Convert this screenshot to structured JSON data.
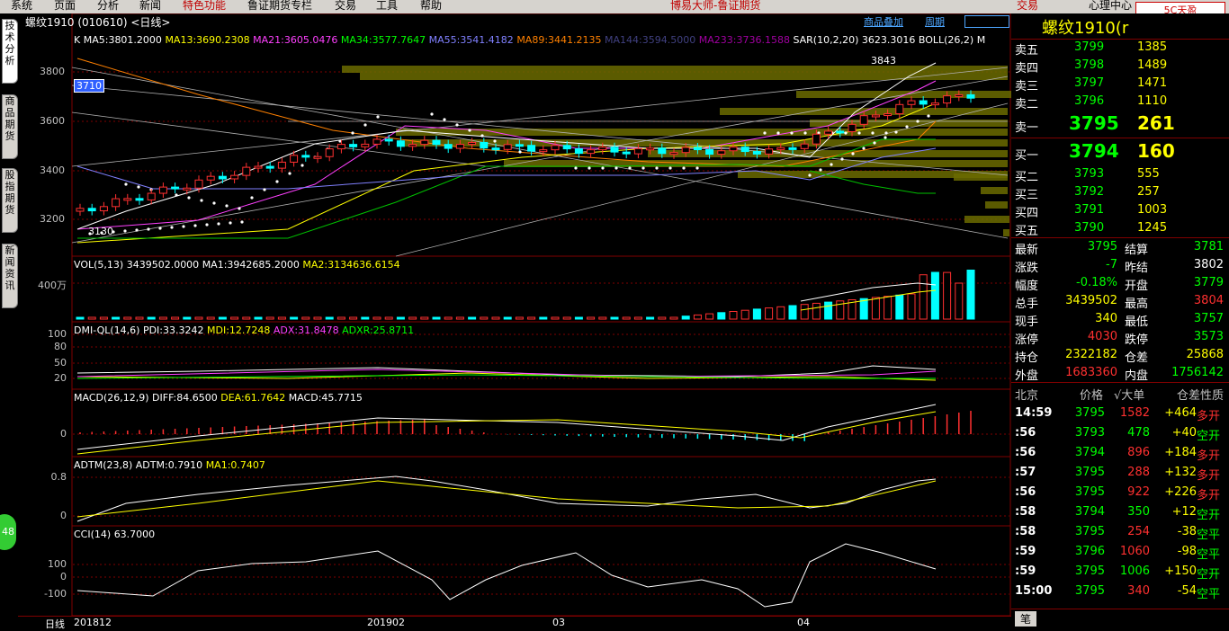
{
  "menu": [
    "系统",
    "页面",
    "分析",
    "新闻",
    "特色功能",
    "鲁证期货专栏",
    "交易",
    "工具",
    "帮助"
  ],
  "app_title": "博易大师-鲁证期货",
  "top_right": {
    "trade": "交易",
    "mind": "心理中心"
  },
  "left_tabs": [
    "技术分析",
    "商品期货",
    "股指期货",
    "新闻资讯"
  ],
  "left_badge": "48",
  "chart": {
    "header": "螺纹1910 (010610) <日线>",
    "overlay_btn": "商品叠加",
    "period_btn": "周期",
    "ma_line": {
      "k": "K",
      "ma5": "MA5:3801.2000",
      "ma13": "MA13:3690.2308",
      "ma21": "MA21:3605.0476",
      "ma34": "MA34:3577.7647",
      "ma55": "MA55:3541.4182",
      "ma89": "MA89:3441.2135",
      "ma144": "MA144:3594.5000",
      "ma233": "MA233:3736.1588",
      "sar": "SAR(10,2,20)",
      "sar_val": "3623.3016",
      "boll": "BOLL(26,2)",
      "boll_m": "M"
    },
    "price_axis": [
      "3800",
      "3600",
      "3400",
      "3200"
    ],
    "price_tag": "3710",
    "high_label": "3843",
    "low_label": "3130",
    "vol_line": {
      "title": "VOL(5,13)",
      "v": "3439502.0000",
      "ma1": "MA1:3942685.2000",
      "ma2": "MA2:3134636.6154"
    },
    "vol_axis": "400万",
    "dmi_line": {
      "title": "DMI-QL(14,6)",
      "pdi": "PDI:33.3242",
      "mdi": "MDI:12.7248",
      "adx": "ADX:31.8478",
      "adxr": "ADXR:25.8711"
    },
    "dmi_axis": [
      "100",
      "80",
      "50",
      "20"
    ],
    "macd_line": {
      "title": "MACD(26,12,9)",
      "diff": "DIFF:84.6500",
      "dea": "DEA:61.7642",
      "macd": "MACD:45.7715"
    },
    "macd_axis": "0",
    "adtm_line": {
      "title": "ADTM(23,8)",
      "adtm": "ADTM:0.7910",
      "ma1": "MA1:0.7407"
    },
    "adtm_axis": [
      "0.8",
      "0"
    ],
    "cci_line": {
      "title": "CCI(14)",
      "val": "63.7000"
    },
    "cci_axis": [
      "100",
      "0",
      "-100"
    ],
    "bottom": {
      "period": "日线",
      "d1": "201812",
      "d2": "201902",
      "d3": "03",
      "d4": "04"
    }
  },
  "right": {
    "title": "螺纹1910(r",
    "asks": [
      {
        "label": "卖五",
        "price": "3799",
        "vol": "1385"
      },
      {
        "label": "卖四",
        "price": "3798",
        "vol": "1489"
      },
      {
        "label": "卖三",
        "price": "3797",
        "vol": "1471"
      },
      {
        "label": "卖二",
        "price": "3796",
        "vol": "1110"
      }
    ],
    "ask1": {
      "label": "卖一",
      "price": "3795",
      "vol": "261"
    },
    "bid1": {
      "label": "买一",
      "price": "3794",
      "vol": "160"
    },
    "bids": [
      {
        "label": "买二",
        "price": "3793",
        "vol": "555"
      },
      {
        "label": "买三",
        "price": "3792",
        "vol": "257"
      },
      {
        "label": "买四",
        "price": "3791",
        "vol": "1003"
      },
      {
        "label": "买五",
        "price": "3790",
        "vol": "1245"
      }
    ],
    "stats": [
      {
        "l1": "最新",
        "v1": "3795",
        "c1": "green",
        "l2": "结算",
        "v2": "3781",
        "c2": "green"
      },
      {
        "l1": "涨跌",
        "v1": "-7",
        "c1": "green",
        "l2": "昨结",
        "v2": "3802",
        "c2": "white"
      },
      {
        "l1": "幅度",
        "v1": "-0.18%",
        "c1": "green",
        "l2": "开盘",
        "v2": "3779",
        "c2": "green"
      },
      {
        "l1": "总手",
        "v1": "3439502",
        "c1": "yellow",
        "l2": "最高",
        "v2": "3804",
        "c2": "red"
      },
      {
        "l1": "现手",
        "v1": "340",
        "c1": "yellow",
        "l2": "最低",
        "v2": "3757",
        "c2": "green"
      },
      {
        "l1": "涨停",
        "v1": "4030",
        "c1": "red",
        "l2": "跌停",
        "v2": "3573",
        "c2": "green"
      },
      {
        "l1": "持仓",
        "v1": "2322182",
        "c1": "yellow",
        "l2": "仓差",
        "v2": "25868",
        "c2": "yellow"
      },
      {
        "l1": "外盘",
        "v1": "1683360",
        "c1": "red",
        "l2": "内盘",
        "v2": "1756142",
        "c2": "green"
      }
    ],
    "ticks_header": {
      "a": "北京",
      "b": "价格",
      "c": "√大单",
      "d": "仓差",
      "e": "性质"
    },
    "ticks": [
      {
        "t": "14:59",
        "p": "3795",
        "v": "1582",
        "vc": "red",
        "d": "+464",
        "n": "多开",
        "nc": "red"
      },
      {
        "t": ":56",
        "p": "3793",
        "v": "478",
        "vc": "green",
        "d": "+40",
        "n": "空开",
        "nc": "green"
      },
      {
        "t": ":56",
        "p": "3794",
        "v": "896",
        "vc": "red",
        "d": "+184",
        "n": "多开",
        "nc": "red"
      },
      {
        "t": ":57",
        "p": "3795",
        "v": "288",
        "vc": "red",
        "d": "+132",
        "n": "多开",
        "nc": "red"
      },
      {
        "t": ":56",
        "p": "3795",
        "v": "922",
        "vc": "red",
        "d": "+226",
        "n": "多开",
        "nc": "red"
      },
      {
        "t": ":58",
        "p": "3794",
        "v": "350",
        "vc": "green",
        "d": "+12",
        "n": "空开",
        "nc": "green"
      },
      {
        "t": ":58",
        "p": "3795",
        "v": "254",
        "vc": "red",
        "d": "-38",
        "n": "空平",
        "nc": "green"
      },
      {
        "t": ":59",
        "p": "3796",
        "v": "1060",
        "vc": "red",
        "d": "-98",
        "n": "空平",
        "nc": "green"
      },
      {
        "t": ":59",
        "p": "3795",
        "v": "1006",
        "vc": "green",
        "d": "+150",
        "n": "空开",
        "nc": "green"
      },
      {
        "t": "15:00",
        "p": "3795",
        "v": "340",
        "vc": "red",
        "d": "-54",
        "n": "空平",
        "nc": "green"
      }
    ],
    "bottom_tab": "笔"
  },
  "colors": {
    "bg": "#000000",
    "up": "#ff3030",
    "down": "#00ffff",
    "grid": "#800000"
  }
}
